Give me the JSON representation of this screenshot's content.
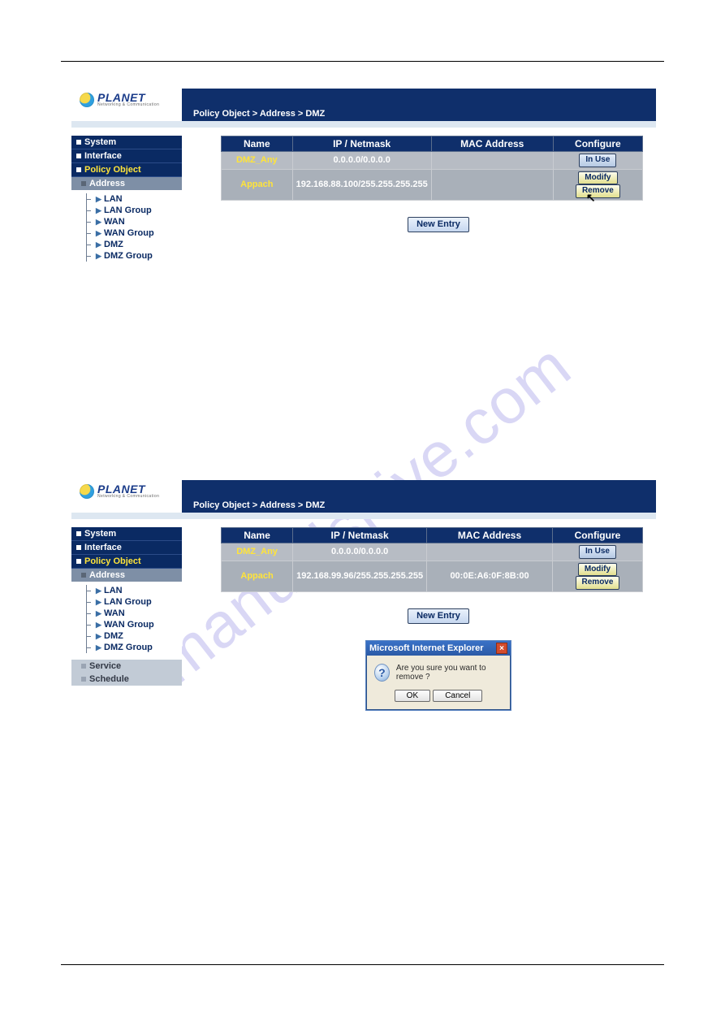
{
  "watermark": "manualshive.com",
  "brand": {
    "name": "PLANET",
    "tagline": "Networking & Communication"
  },
  "common": {
    "breadcrumb": "Policy Object > Address > DMZ",
    "columns": {
      "name": "Name",
      "ip": "IP / Netmask",
      "mac": "MAC Address",
      "configure": "Configure"
    },
    "buttons": {
      "new_entry": "New Entry",
      "modify": "Modify",
      "remove": "Remove",
      "in_use": "In Use"
    },
    "sidebar": {
      "top": [
        "System",
        "Interface",
        "Policy Object"
      ],
      "address_label": "Address",
      "tree": [
        "LAN",
        "LAN Group",
        "WAN",
        "WAN Group",
        "DMZ",
        "DMZ Group"
      ],
      "extra": [
        "Service",
        "Schedule"
      ]
    }
  },
  "panel1": {
    "rows": [
      {
        "name": "DMZ_Any",
        "ip": "0.0.0.0/0.0.0.0",
        "mac": "",
        "configure": "inuse"
      },
      {
        "name": "Appach",
        "ip": "192.168.88.100/255.255.255.255",
        "mac": "",
        "configure": "modify_remove"
      }
    ]
  },
  "panel2": {
    "rows": [
      {
        "name": "DMZ_Any",
        "ip": "0.0.0.0/0.0.0.0",
        "mac": "",
        "configure": "inuse"
      },
      {
        "name": "Appach",
        "ip": "192.168.99.96/255.255.255.255",
        "mac": "00:0E:A6:0F:8B:00",
        "configure": "modify_remove"
      }
    ]
  },
  "dialog": {
    "title": "Microsoft Internet Explorer",
    "message": "Are you sure you want to remove ?",
    "ok": "OK",
    "cancel": "Cancel"
  }
}
